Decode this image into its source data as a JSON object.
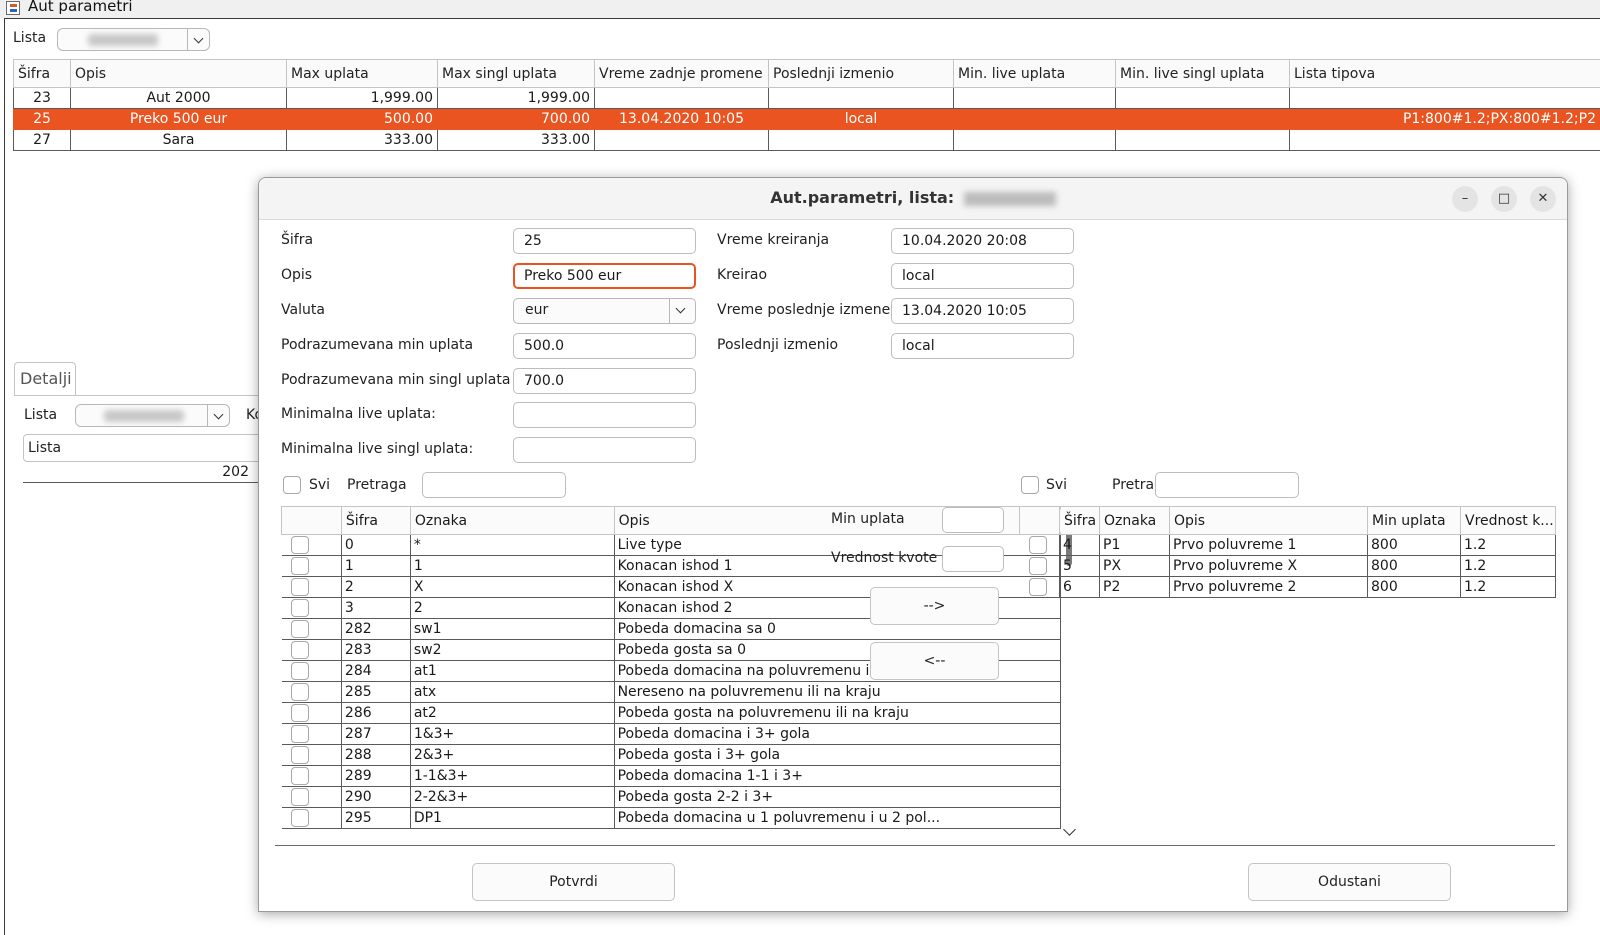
{
  "window": {
    "title": "Aut parametri"
  },
  "main": {
    "lista_label": "Lista",
    "table": {
      "columns": [
        "Šifra",
        "Opis",
        "Max uplata",
        "Max singl uplata",
        "Vreme zadnje promene",
        "Poslednji izmenio",
        "Min. live uplata",
        "Min. live singl uplata",
        "Lista tipova"
      ],
      "rows": [
        {
          "sifra": "23",
          "opis": "Aut 2000",
          "max": "1,999.00",
          "max_singl": "1,999.00",
          "vreme": "",
          "izmenio": "",
          "min_live": "",
          "min_live_singl": "",
          "lista_tipova": ""
        },
        {
          "sifra": "25",
          "opis": "Preko 500 eur",
          "max": "500.00",
          "max_singl": "700.00",
          "vreme": "13.04.2020 10:05",
          "izmenio": "local",
          "min_live": "",
          "min_live_singl": "",
          "lista_tipova": "P1:800#1.2;PX:800#1.2;P2"
        },
        {
          "sifra": "27",
          "opis": "Sara",
          "max": "333.00",
          "max_singl": "333.00",
          "vreme": "",
          "izmenio": "",
          "min_live": "",
          "min_live_singl": "",
          "lista_tipova": ""
        }
      ]
    },
    "detalji": {
      "tab": "Detalji",
      "lista_label": "Lista",
      "ko_label": "Ko",
      "lista_header": "Lista",
      "lista_value": "202"
    }
  },
  "dialog": {
    "title": "Aut.parametri, lista:",
    "fields": {
      "sifra_label": "Šifra",
      "sifra": "25",
      "opis_label": "Opis",
      "opis": "Preko 500 eur",
      "valuta_label": "Valuta",
      "valuta": "eur",
      "pod_min_label": "Podrazumevana min uplata",
      "pod_min": "500.0",
      "pod_min_singl_label": "Podrazumevana min singl uplata",
      "pod_min_singl": "700.0",
      "min_live_label": "Minimalna live uplata:",
      "min_live": "",
      "min_live_singl_label": "Minimalna live singl uplata:",
      "min_live_singl": "",
      "vreme_kreiranja_label": "Vreme kreiranja",
      "vreme_kreiranja": "10.04.2020 20:08",
      "kreirao_label": "Kreirao",
      "kreirao": "local",
      "vreme_izmene_label": "Vreme poslednje izmene",
      "vreme_izmene": "13.04.2020 10:05",
      "poslednji_label": "Poslednji izmenio",
      "poslednji": "local"
    },
    "left": {
      "svi": "Svi",
      "pretraga": "Pretraga",
      "columns": [
        "Šifra",
        "Oznaka",
        "Opis"
      ],
      "rows": [
        {
          "sifra": "0",
          "oznaka": "*",
          "opis": "Live type"
        },
        {
          "sifra": "1",
          "oznaka": "1",
          "opis": "Konacan ishod 1"
        },
        {
          "sifra": "2",
          "oznaka": "X",
          "opis": "Konacan ishod X"
        },
        {
          "sifra": "3",
          "oznaka": "2",
          "opis": "Konacan ishod 2"
        },
        {
          "sifra": "282",
          "oznaka": "sw1",
          "opis": "Pobeda domacina sa 0"
        },
        {
          "sifra": "283",
          "oznaka": "sw2",
          "opis": "Pobeda gosta sa 0"
        },
        {
          "sifra": "284",
          "oznaka": "at1",
          "opis": "Pobeda domacina na poluvremenu ili na kraju"
        },
        {
          "sifra": "285",
          "oznaka": "atx",
          "opis": "Nereseno na poluvremenu ili na kraju"
        },
        {
          "sifra": "286",
          "oznaka": "at2",
          "opis": "Pobeda gosta na poluvremenu ili na kraju"
        },
        {
          "sifra": "287",
          "oznaka": "1&3+",
          "opis": "Pobeda domacina i 3+ gola"
        },
        {
          "sifra": "288",
          "oznaka": "2&3+",
          "opis": "Pobeda gosta i 3+ gola"
        },
        {
          "sifra": "289",
          "oznaka": "1-1&3+",
          "opis": "Pobeda domacina 1-1 i 3+"
        },
        {
          "sifra": "290",
          "oznaka": "2-2&3+",
          "opis": "Pobeda gosta 2-2 i 3+"
        },
        {
          "sifra": "295",
          "oznaka": "DP1",
          "opis": "Pobeda domacina u 1 poluvremenu i u 2 pol..."
        }
      ]
    },
    "middle": {
      "min_uplata": "Min uplata",
      "vrednost_kvote": "Vrednost kvote",
      "add": "-->",
      "remove": "<--"
    },
    "right": {
      "svi": "Svi",
      "pretraga": "Pretraga",
      "columns": [
        "Šifra",
        "Oznaka",
        "Opis",
        "Min uplata",
        "Vrednost k..."
      ],
      "rows": [
        {
          "sifra": "4",
          "oznaka": "P1",
          "opis": "Prvo poluvreme 1",
          "min": "800",
          "kvota": "1.2"
        },
        {
          "sifra": "5",
          "oznaka": "PX",
          "opis": "Prvo poluvreme X",
          "min": "800",
          "kvota": "1.2"
        },
        {
          "sifra": "6",
          "oznaka": "P2",
          "opis": "Prvo poluvreme 2",
          "min": "800",
          "kvota": "1.2"
        }
      ]
    },
    "buttons": {
      "confirm": "Potvrdi",
      "cancel": "Odustani"
    },
    "window_buttons": {
      "minimize": "–",
      "maximize": "□",
      "close": "✕"
    }
  }
}
